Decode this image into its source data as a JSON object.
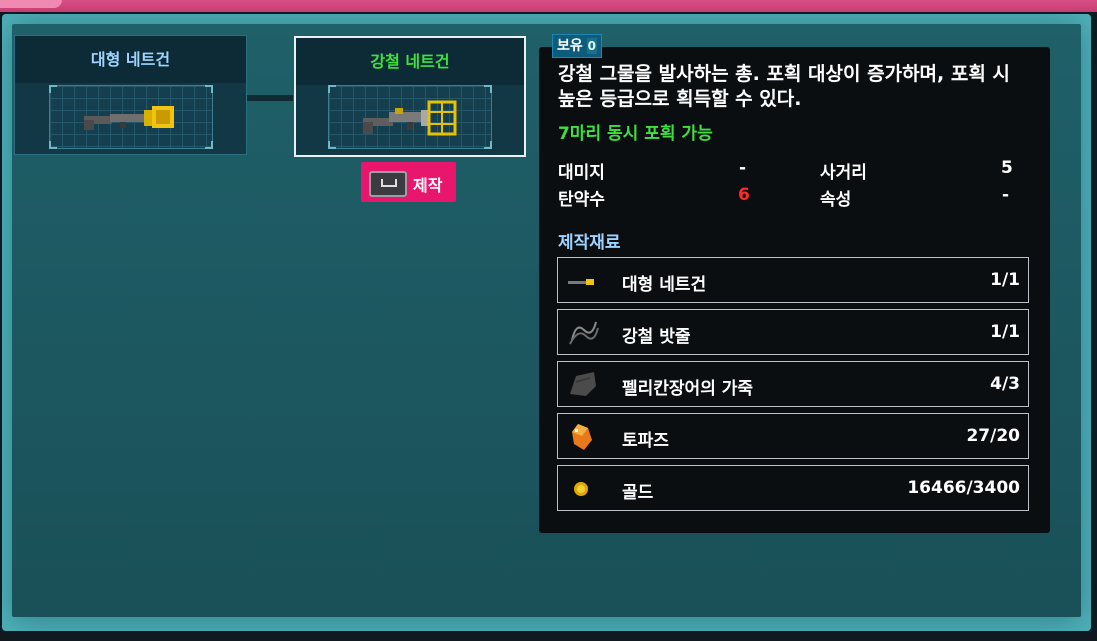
{
  "items": [
    {
      "name": "대형 네트건",
      "name_color": "#9fd3ff",
      "icon": "net-gun-icon"
    },
    {
      "name": "강철 네트건",
      "name_color": "#3fe03f",
      "icon": "steel-net-gun-icon",
      "selected": true
    }
  ],
  "craft_button": {
    "key_icon": "spacebar-key-icon",
    "label": "제작"
  },
  "detail": {
    "owned_label": "보유",
    "owned_count": "0",
    "description": "강철 그물을 발사하는 총. 포획 대상이 증가하며, 포획 시 높은 등급으로 획득할 수 있다.",
    "feature": "7마리 동시 포획 가능",
    "stats": {
      "damage_label": "대미지",
      "damage_value": "-",
      "range_label": "사거리",
      "range_value": "5",
      "ammo_label": "탄약수",
      "ammo_value": "6",
      "element_label": "속성",
      "element_value": "-"
    },
    "materials_title": "제작재료",
    "materials": [
      {
        "name": "대형 네트건",
        "qty": "1/1",
        "icon": "net-gun-icon"
      },
      {
        "name": "강철 밧줄",
        "qty": "1/1",
        "icon": "steel-rope-icon"
      },
      {
        "name": "펠리칸장어의 가죽",
        "qty": "4/3",
        "icon": "leather-icon"
      },
      {
        "name": "토파즈",
        "qty": "27/20",
        "icon": "topaz-icon"
      },
      {
        "name": "골드",
        "qty": "16466/3400",
        "icon": "gold-coin-icon"
      }
    ]
  },
  "colors": {
    "accent": "#e8176d",
    "panel": "#0b0e11",
    "frame": "#2f7d86",
    "ammo_value": "#ff2a2a"
  }
}
